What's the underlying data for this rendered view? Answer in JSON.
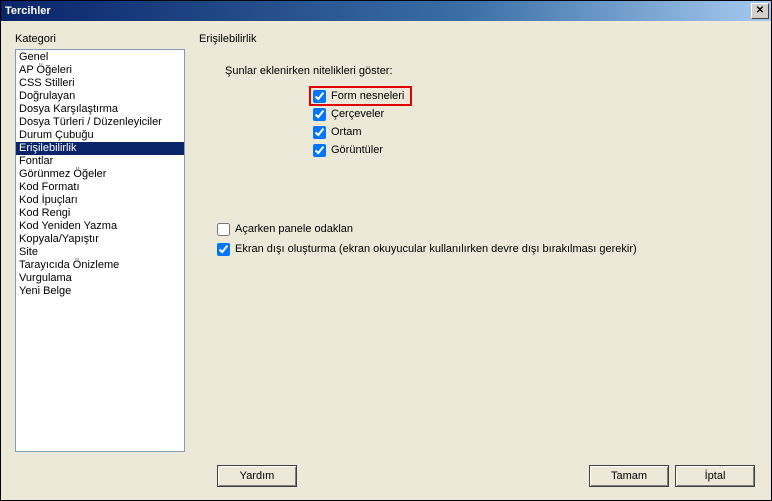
{
  "window": {
    "title": "Tercihler",
    "close_glyph": "✕"
  },
  "left": {
    "label": "Kategori",
    "items": [
      "Genel",
      "AP Öğeleri",
      "CSS Stilleri",
      "Doğrulayan",
      "Dosya Karşılaştırma",
      "Dosya Türleri / Düzenleyiciler",
      "Durum Çubuğu",
      "Erişilebilirlik",
      "Fontlar",
      "Görünmez Öğeler",
      "Kod Formatı",
      "Kod İpuçları",
      "Kod Rengi",
      "Kod Yeniden Yazma",
      "Kopyala/Yapıştır",
      "Site",
      "Tarayıcıda Önizleme",
      "Vurgulama",
      "Yeni Belge"
    ],
    "selected_index": 7
  },
  "right": {
    "section_title": "Erişilebilirlik",
    "group_label": "Şunlar eklenirken nitelikleri göster:",
    "checks": [
      {
        "label": "Form nesneleri",
        "checked": true,
        "highlight": true
      },
      {
        "label": "Çerçeveler",
        "checked": true,
        "highlight": false
      },
      {
        "label": "Ortam",
        "checked": true,
        "highlight": false
      },
      {
        "label": "Görüntüler",
        "checked": true,
        "highlight": false
      }
    ],
    "lower": [
      {
        "label": "Açarken panele odaklan",
        "checked": false
      },
      {
        "label": "Ekran dışı oluşturma (ekran okuyucular kullanılırken devre dışı bırakılması gerekir)",
        "checked": true
      }
    ]
  },
  "buttons": {
    "help": "Yardım",
    "ok": "Tamam",
    "cancel": "İptal"
  }
}
